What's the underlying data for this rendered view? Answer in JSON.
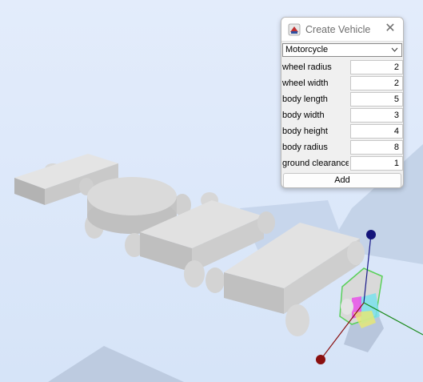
{
  "dialog": {
    "title": "Create Vehicle",
    "close_icon": "close-icon",
    "app_icon": "vehicle-app-icon",
    "vehicle_type": "Motorcycle",
    "fields": [
      {
        "label": "wheel radius",
        "value": "2"
      },
      {
        "label": "wheel width",
        "value": "2"
      },
      {
        "label": "body length",
        "value": "5"
      },
      {
        "label": "body width",
        "value": "3"
      },
      {
        "label": "body height",
        "value": "4"
      },
      {
        "label": "body radius",
        "value": "8"
      },
      {
        "label": "ground clearance",
        "value": "1"
      }
    ],
    "add_label": "Add"
  },
  "scene": {
    "background_color": "#dbe8fb",
    "axis_colors": {
      "x": "#a01010",
      "y": "#101080",
      "z": "#1a8a1a"
    }
  }
}
